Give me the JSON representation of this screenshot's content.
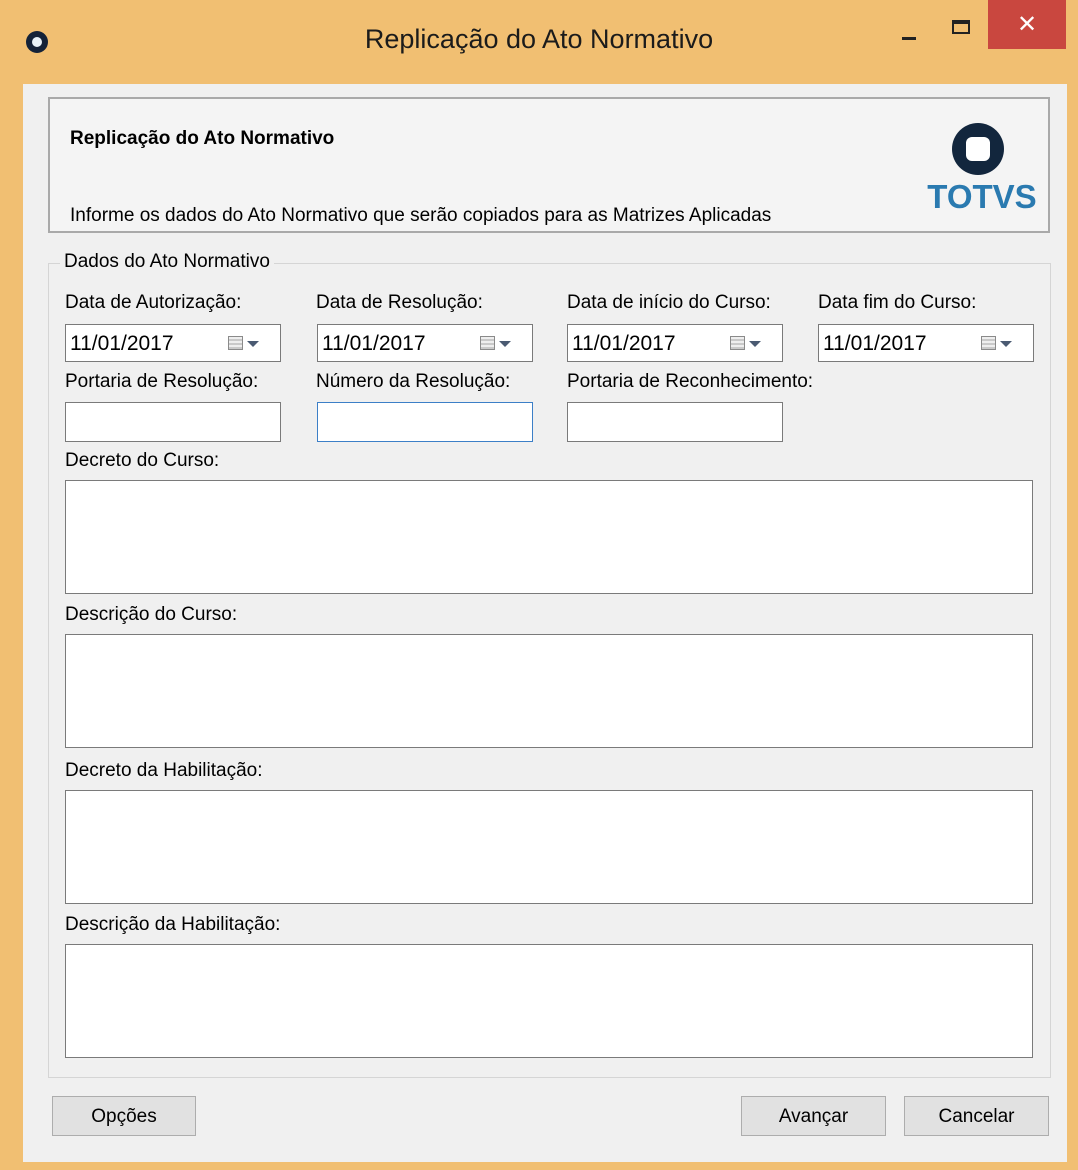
{
  "window": {
    "title": "Replicação do Ato Normativo",
    "close_glyph": "✕",
    "icons": [
      "app-icon",
      "minimize-icon",
      "maximize-icon",
      "close-icon"
    ]
  },
  "header": {
    "title": "Replicação do Ato Normativo",
    "description": "Informe os dados do Ato Normativo que serão copiados para as Matrizes Aplicadas",
    "logo_text": "TOTVS"
  },
  "group": {
    "legend": "Dados do Ato Normativo",
    "dates": [
      {
        "label": "Data de Autorização:",
        "value": "11/01/2017"
      },
      {
        "label": "Data de Resolução:",
        "value": "11/01/2017"
      },
      {
        "label": "Data de início do Curso:",
        "value": "11/01/2017"
      },
      {
        "label": "Data fim do Curso:",
        "value": "11/01/2017"
      }
    ],
    "text_fields": [
      {
        "label": "Portaria de Resolução:",
        "value": ""
      },
      {
        "label": "Número da Resolução:",
        "value": ""
      },
      {
        "label": "Portaria de Reconhecimento:",
        "value": ""
      }
    ],
    "text_areas": [
      {
        "label": "Decreto do Curso:",
        "value": ""
      },
      {
        "label": "Descrição do Curso:",
        "value": ""
      },
      {
        "label": "Decreto da Habilitação:",
        "value": ""
      },
      {
        "label": "Descrição da Habilitação:",
        "value": ""
      }
    ]
  },
  "buttons": {
    "options": "Opções",
    "next": "Avançar",
    "cancel": "Cancelar"
  },
  "colors": {
    "window_frame": "#f1bf72",
    "close_button": "#c9473f",
    "logo_blue": "#2a7ab0",
    "focus_border": "#3c7fc7"
  }
}
